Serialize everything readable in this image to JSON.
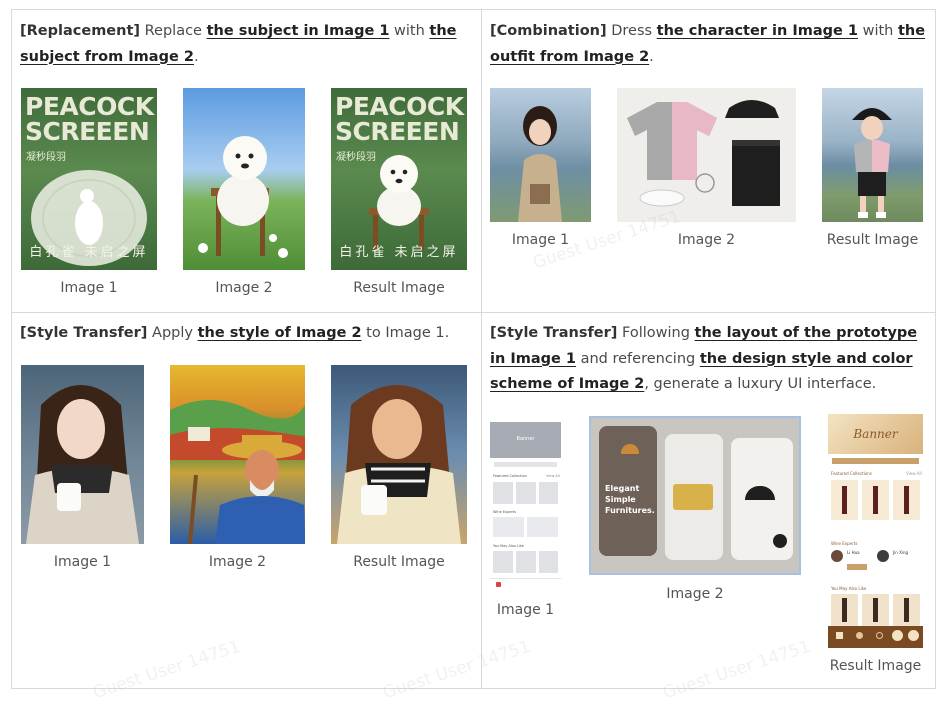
{
  "panels": [
    {
      "tag": "[Replacement]",
      "parts": [
        " Replace ",
        "the subject in Image 1",
        " with ",
        "the subject from Image 2",
        "."
      ],
      "captions": [
        "Image 1",
        "Image 2",
        "Result Image"
      ],
      "poster_title": "PEACOCK SCREEEN",
      "poster_subtitle": "白孔雀   未启之屏",
      "poster_side": "凝秒段羽"
    },
    {
      "tag": "[Combination]",
      "parts": [
        " Dress ",
        "the character in Image 1",
        " with ",
        "the outfit from Image 2",
        "."
      ],
      "captions": [
        "Image 1",
        "Image 2",
        "Result Image"
      ]
    },
    {
      "tag": "[Style Transfer]",
      "parts": [
        " Apply ",
        "the style of Image 2",
        " to Image 1."
      ],
      "captions": [
        "Image 1",
        "Image 2",
        "Result Image"
      ]
    },
    {
      "tag": "[Style Transfer]",
      "parts": [
        " Following ",
        "the layout of the prototype in Image 1",
        " and referencing ",
        "the design style and color scheme of Image 2",
        ", generate a luxury UI interface."
      ],
      "captions": [
        "Image 1",
        "Image 2",
        "Result Image"
      ],
      "ui": {
        "banner_left": "Banner",
        "featured": "Featured Collection",
        "experts": "Wine Experts",
        "may_like": "You May Also Like",
        "view_all": "View All",
        "elegant": "Elegant",
        "simple": "Simple",
        "furnitures": "Furnitures.",
        "banner_right": "Banner",
        "featured_right": "Featured Collections",
        "experts_right": "Wine Experts",
        "expert1": "Li Hua",
        "expert2": "Jin Xing",
        "may_like_right": "You May Also Like"
      }
    }
  ],
  "watermark": "Guest User 14751",
  "colors": {
    "accent_brown": "#8a5a2b",
    "peacock_green": "#4f7a43",
    "border": "#d9d9d9"
  }
}
